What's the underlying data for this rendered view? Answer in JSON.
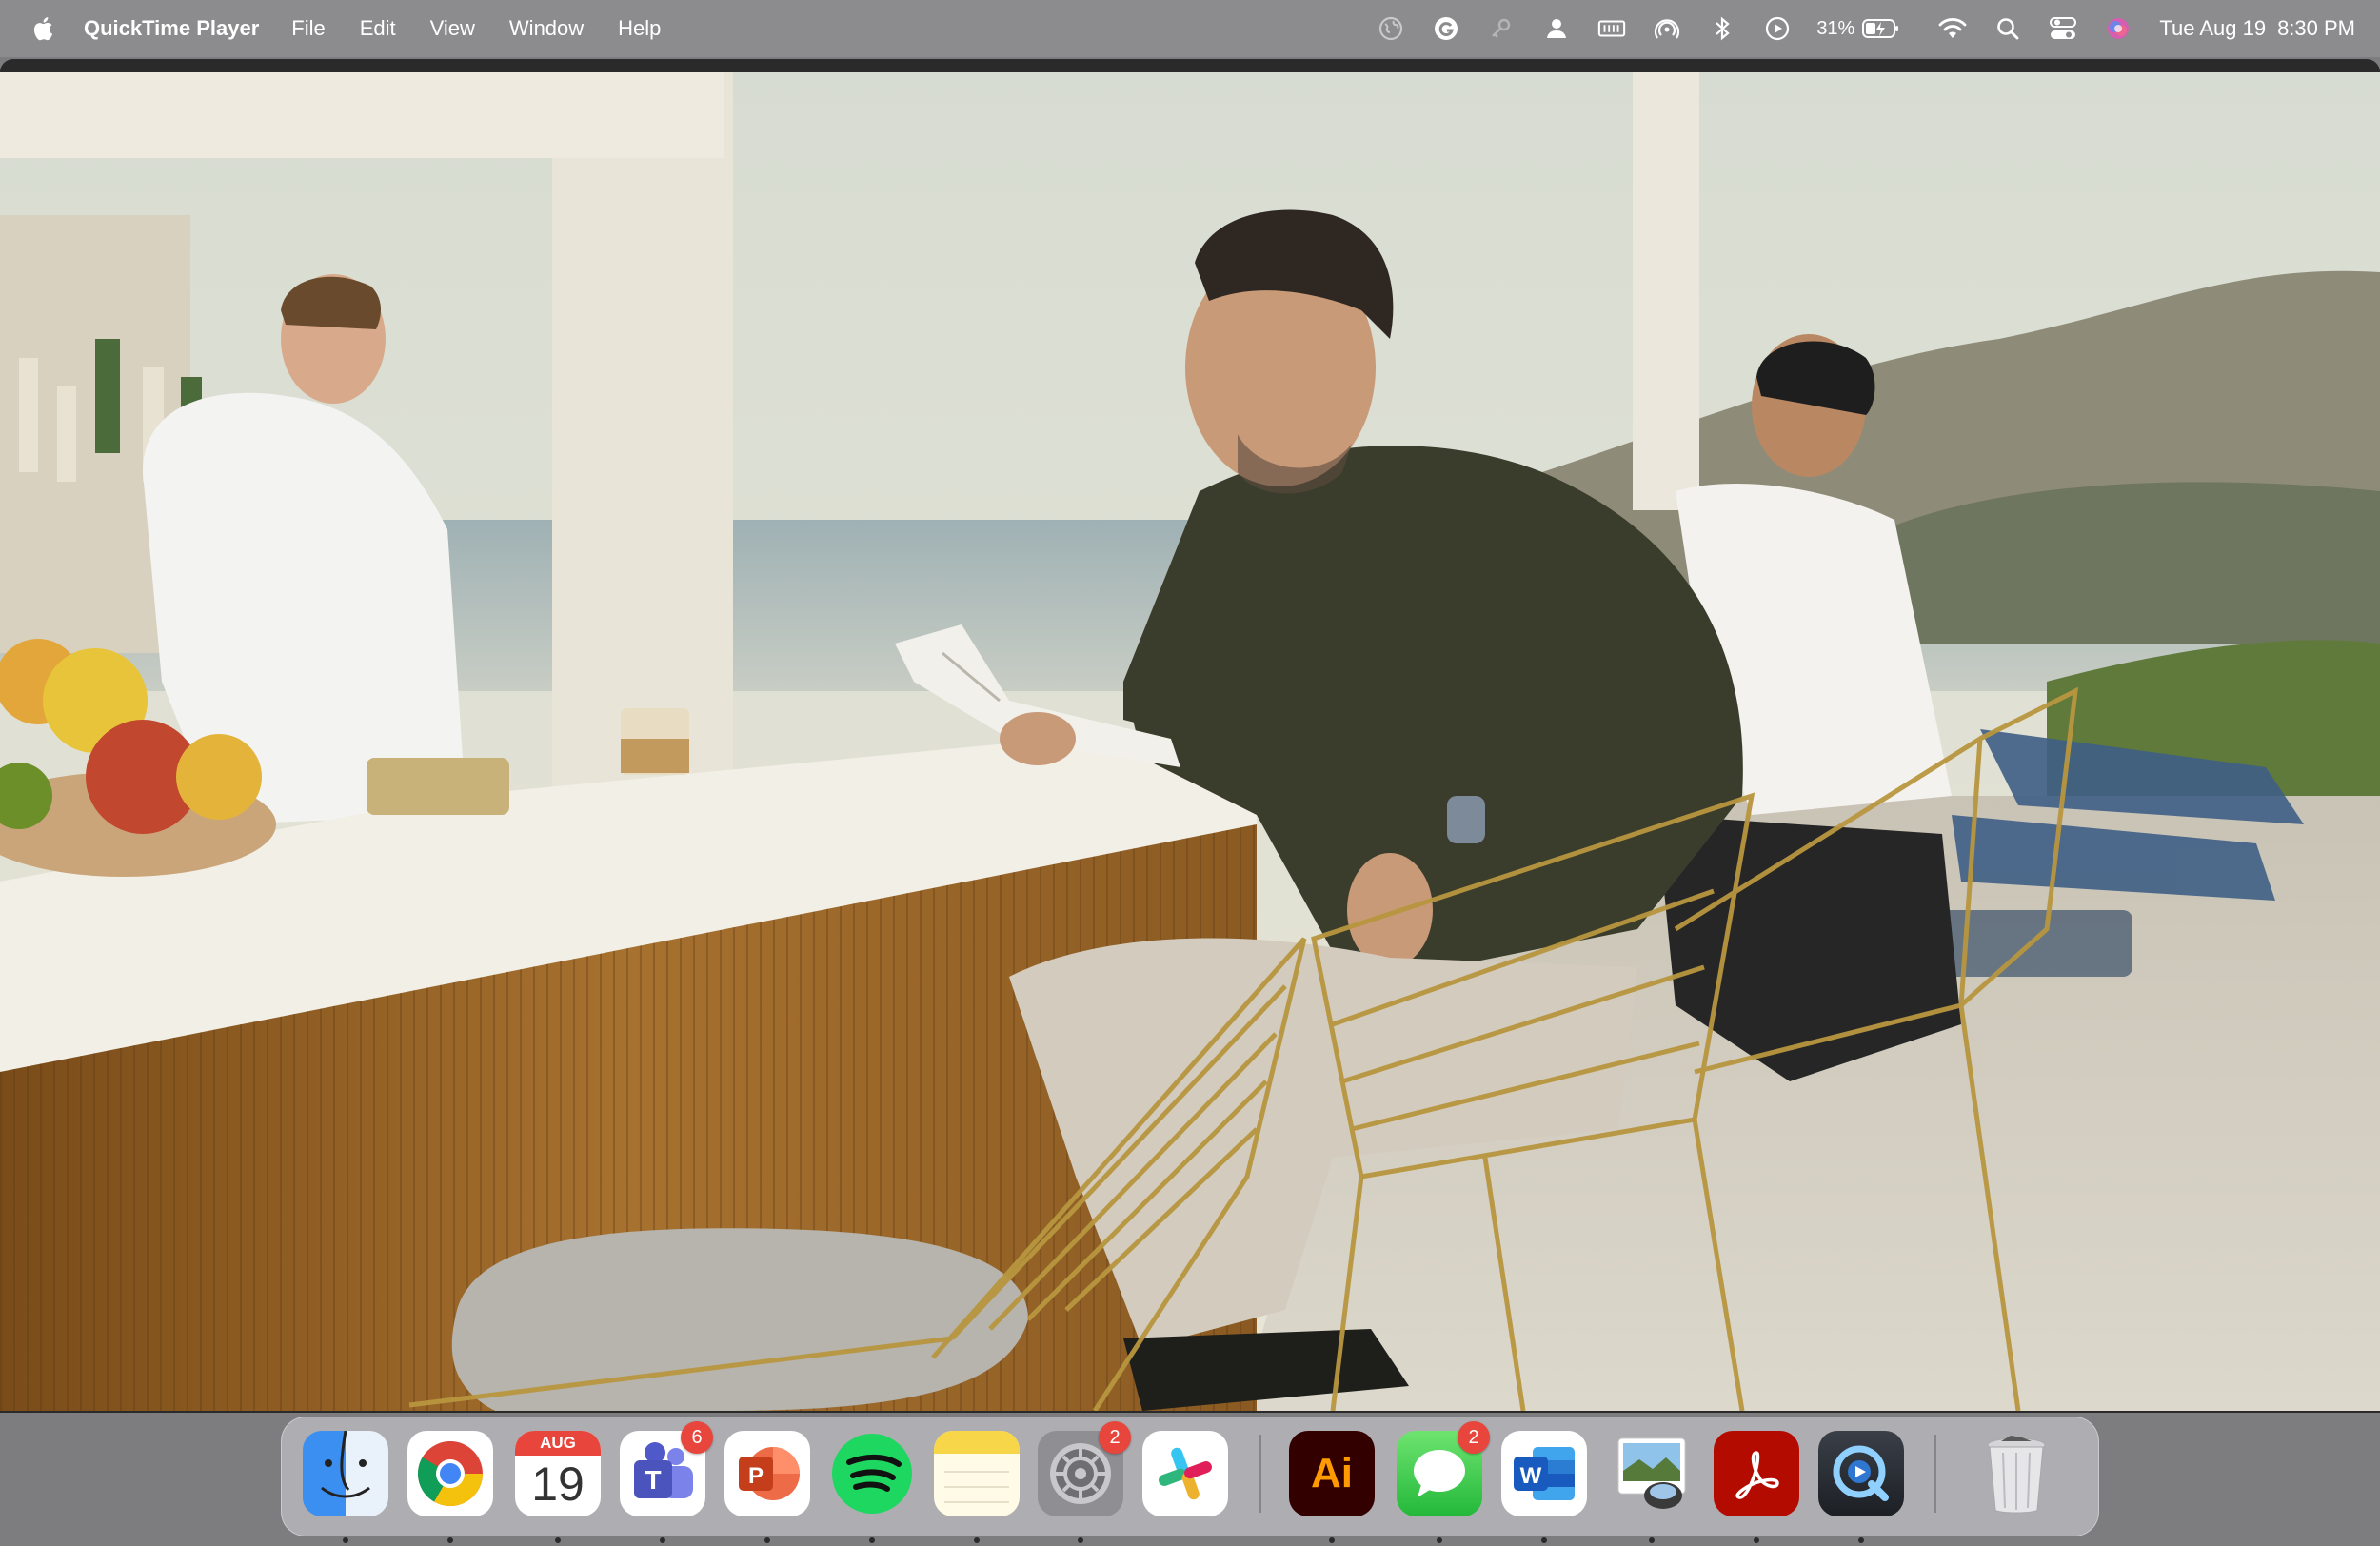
{
  "menubar": {
    "app_name": "QuickTime Player",
    "menus": [
      "File",
      "Edit",
      "View",
      "Window",
      "Help"
    ],
    "battery_percent": "31%",
    "date": "Tue Aug 19",
    "time": "8:30 PM",
    "status_icons": [
      "globe-icon",
      "grammarly-icon",
      "key-icon",
      "user-icon",
      "memory-icon",
      "airdrop-icon",
      "bluetooth-icon",
      "play-circle-icon",
      "battery-icon",
      "wifi-icon",
      "search-icon",
      "control-center-icon",
      "siri-icon"
    ]
  },
  "video": {
    "description_icon": "video-frame"
  },
  "dock": {
    "items": [
      {
        "name": "Finder",
        "icon": "finder-icon",
        "running": true
      },
      {
        "name": "Google Chrome",
        "icon": "chrome-icon",
        "running": true
      },
      {
        "name": "Calendar",
        "icon": "calendar-icon",
        "running": true,
        "month": "AUG",
        "day": "19"
      },
      {
        "name": "Microsoft Teams",
        "icon": "teams-icon",
        "running": true,
        "badge": "6"
      },
      {
        "name": "Microsoft PowerPoint",
        "icon": "powerpoint-icon",
        "running": true
      },
      {
        "name": "Spotify",
        "icon": "spotify-icon",
        "running": true
      },
      {
        "name": "Notes",
        "icon": "notes-icon",
        "running": true
      },
      {
        "name": "System Settings",
        "icon": "settings-icon",
        "running": true,
        "badge": "2"
      },
      {
        "name": "Slack",
        "icon": "slack-icon",
        "running": false
      },
      {
        "name": "Adobe Illustrator",
        "icon": "illustrator-icon",
        "running": true,
        "label": "Ai"
      },
      {
        "name": "Messages",
        "icon": "messages-icon",
        "running": true,
        "badge": "2"
      },
      {
        "name": "Microsoft Word",
        "icon": "word-icon",
        "running": true
      },
      {
        "name": "Preview",
        "icon": "preview-icon",
        "running": true
      },
      {
        "name": "Adobe Acrobat",
        "icon": "acrobat-icon",
        "running": true
      },
      {
        "name": "QuickTime Player",
        "icon": "quicktime-icon",
        "running": true
      },
      {
        "name": "Trash",
        "icon": "trash-icon",
        "running": false
      }
    ]
  }
}
